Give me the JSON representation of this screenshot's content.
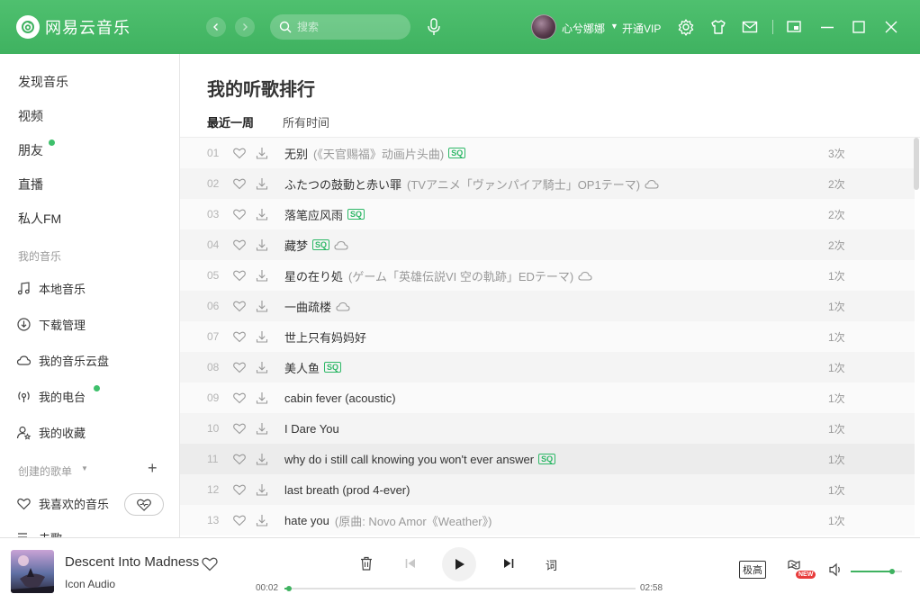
{
  "app": {
    "name": "网易云音乐",
    "accent": "#3fb260"
  },
  "search": {
    "placeholder": "搜索"
  },
  "header": {
    "username": "心兮娜娜",
    "vip_label": "开通VIP"
  },
  "sidebar": {
    "main_items": [
      {
        "label": "发现音乐"
      },
      {
        "label": "视频"
      },
      {
        "label": "朋友",
        "dot": true
      },
      {
        "label": "直播"
      },
      {
        "label": "私人FM"
      }
    ],
    "my_music_title": "我的音乐",
    "my_music": [
      {
        "label": "本地音乐",
        "icon": "music-note-icon"
      },
      {
        "label": "下载管理",
        "icon": "download-circle-icon"
      },
      {
        "label": "我的音乐云盘",
        "icon": "cloud-icon"
      },
      {
        "label": "我的电台",
        "icon": "radio-icon",
        "dot": true
      },
      {
        "label": "我的收藏",
        "icon": "user-star-icon"
      }
    ],
    "created_title": "创建的歌单",
    "created": [
      {
        "label": "我喜欢的音乐",
        "icon": "heart-icon"
      },
      {
        "label": "未歌",
        "icon": "playlist-icon"
      }
    ]
  },
  "main": {
    "title": "我的听歌排行",
    "tabs": [
      "最近一周",
      "所有时间"
    ],
    "songs": [
      {
        "rank": "01",
        "title": "无别",
        "alias": "(《天官赐福》动画片头曲)",
        "sq": true,
        "cloud": false,
        "plays": "3次"
      },
      {
        "rank": "02",
        "title": "ふたつの鼓動と赤い罪",
        "alias": "(TVアニメ「ヴァンパイア騎士」OP1テーマ)",
        "sq": false,
        "cloud": true,
        "plays": "2次"
      },
      {
        "rank": "03",
        "title": "落笔应风雨",
        "alias": "",
        "sq": true,
        "cloud": false,
        "plays": "2次"
      },
      {
        "rank": "04",
        "title": "藏梦",
        "alias": "",
        "sq": true,
        "cloud": true,
        "plays": "2次"
      },
      {
        "rank": "05",
        "title": "星の在り処",
        "alias": "(ゲーム「英雄伝説VI 空の軌跡」EDテーマ)",
        "sq": false,
        "cloud": true,
        "plays": "1次"
      },
      {
        "rank": "06",
        "title": "一曲疏楼",
        "alias": "",
        "sq": false,
        "cloud": true,
        "plays": "1次"
      },
      {
        "rank": "07",
        "title": "世上只有妈妈好",
        "alias": "",
        "sq": false,
        "cloud": false,
        "plays": "1次"
      },
      {
        "rank": "08",
        "title": "美人鱼",
        "alias": "",
        "sq": true,
        "cloud": false,
        "plays": "1次"
      },
      {
        "rank": "09",
        "title": "cabin fever (acoustic)",
        "alias": "",
        "sq": false,
        "cloud": false,
        "plays": "1次"
      },
      {
        "rank": "10",
        "title": "I Dare You",
        "alias": "",
        "sq": false,
        "cloud": false,
        "plays": "1次"
      },
      {
        "rank": "11",
        "title": "why do i still call knowing you won't ever answer",
        "alias": "",
        "sq": true,
        "cloud": false,
        "plays": "1次"
      },
      {
        "rank": "12",
        "title": "last breath (prod 4-ever)",
        "alias": "",
        "sq": false,
        "cloud": false,
        "plays": "1次"
      },
      {
        "rank": "13",
        "title": "hate you",
        "alias": "(原曲: Novo Amor《Weather》)",
        "sq": false,
        "cloud": false,
        "plays": "1次"
      }
    ],
    "sq_label": "SQ"
  },
  "player": {
    "title": "Descent Into Madness",
    "artist": "Icon Audio",
    "elapsed": "00:02",
    "duration": "02:58",
    "progress": 0.012,
    "lyric_label": "词",
    "quality_label": "极高",
    "new_label": "NEW",
    "volume": 0.8
  }
}
